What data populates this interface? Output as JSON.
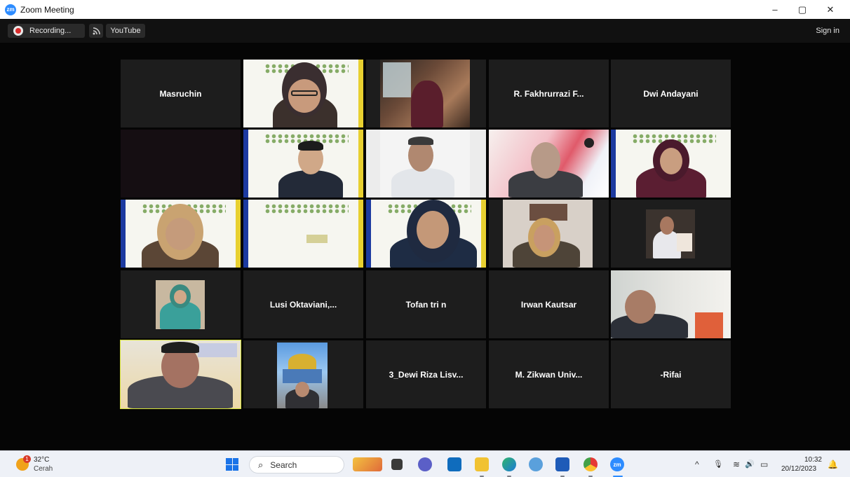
{
  "window": {
    "title": "Zoom Meeting",
    "logo_text": "zm",
    "controls": {
      "minimize": "–",
      "restore": "▢",
      "close": "✕"
    }
  },
  "toolbar": {
    "recording_label": "Recording...",
    "live_icon": "rss-icon",
    "youtube_label": "YouTube",
    "signin_label": "Sign in"
  },
  "participants": [
    {
      "name": "Masruchin",
      "video": false
    },
    {
      "name": "",
      "video": true
    },
    {
      "name": "",
      "video": true
    },
    {
      "name": "R. Fakhrurrazi F...",
      "video": false
    },
    {
      "name": "Dwi Andayani",
      "video": false
    },
    {
      "name": "",
      "video": false
    },
    {
      "name": "",
      "video": true
    },
    {
      "name": "",
      "video": true
    },
    {
      "name": "",
      "video": true
    },
    {
      "name": "",
      "video": true
    },
    {
      "name": "",
      "video": true
    },
    {
      "name": "",
      "video": true
    },
    {
      "name": "",
      "video": true
    },
    {
      "name": "",
      "video": true
    },
    {
      "name": "",
      "video": true
    },
    {
      "name": "",
      "video": true
    },
    {
      "name": "Lusi  Oktaviani,...",
      "video": false
    },
    {
      "name": "Tofan tri n",
      "video": false
    },
    {
      "name": "Irwan Kautsar",
      "video": false
    },
    {
      "name": "",
      "video": true
    },
    {
      "name": "",
      "video": true
    },
    {
      "name": "",
      "video": true
    },
    {
      "name": "3_Dewi Riza Lisv...",
      "video": false
    },
    {
      "name": "M. Zikwan Univ...",
      "video": false
    },
    {
      "name": "-Rifai",
      "video": false
    }
  ],
  "taskbar": {
    "weather_temp": "32°C",
    "weather_cond": "Cerah",
    "weather_badge": "1",
    "search_label": "Search",
    "clock_time": "10:32",
    "clock_date": "20/12/2023",
    "apps": [
      "widgets-icon",
      "file-explorer-icon",
      "teams-chat-icon",
      "mail-icon",
      "folder-icon",
      "edge-icon",
      "photos-icon",
      "word-icon",
      "chrome-icon",
      "zoom-icon"
    ],
    "zoom_app_label": "zm",
    "tray_icons": [
      "chevron-up-icon",
      "microphone-icon",
      "wifi-icon",
      "speaker-icon",
      "battery-icon",
      "bell-icon"
    ],
    "tray_glyphs": {
      "chevron": "^",
      "mic": "🎙",
      "wifi": "≋",
      "speaker": "🔊",
      "battery": "▭",
      "bell": "🔔"
    }
  },
  "colors": {
    "zoom_blue": "#2d8cff",
    "active_speaker_border": "#d6e33a",
    "tile_bg": "#1d1d1d",
    "recording_red": "#d92c2c"
  }
}
